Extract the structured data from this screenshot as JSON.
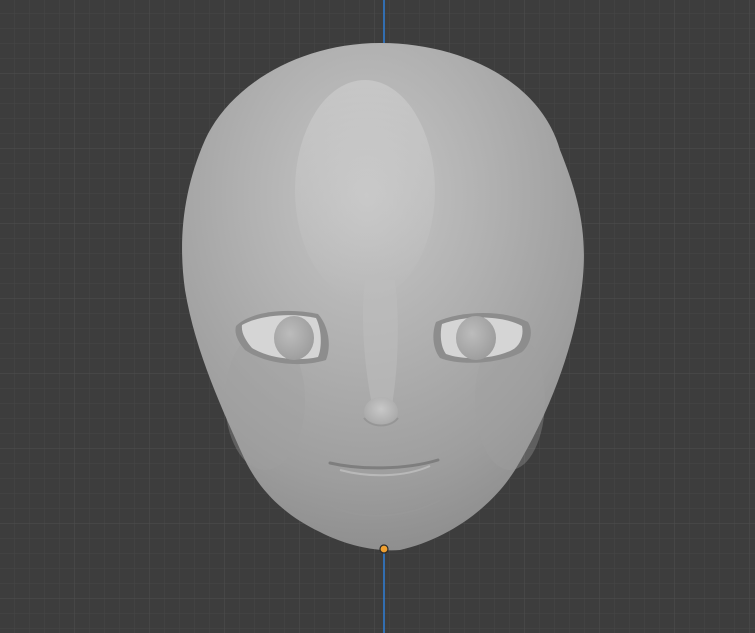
{
  "viewport": {
    "view": "front-orthographic",
    "background_color": "#3d3d3d",
    "grid_minor_color": "#474747",
    "grid_major_color": "#505050",
    "z_axis_color": "#2f7fd8",
    "origin_color": "#f0a030",
    "mesh_color": "#a9a9a9"
  },
  "object": {
    "icon": "object-origin-icon",
    "type": "mesh-head-sculpt"
  }
}
